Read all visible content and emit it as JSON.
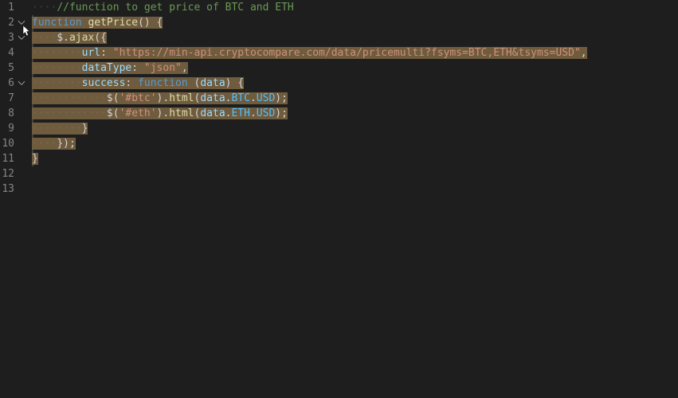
{
  "lines": [
    {
      "n": 1,
      "fold": false,
      "sel": [],
      "tokens": [
        {
          "t": "ws",
          "v": "····"
        },
        {
          "t": "comment",
          "v": "//function to get price of BTC and ETH"
        }
      ]
    },
    {
      "n": 2,
      "fold": true,
      "sel": [
        [
          0,
          99
        ]
      ],
      "tokens": [
        {
          "t": "keyword",
          "v": "function"
        },
        {
          "t": "punct",
          "v": " "
        },
        {
          "t": "funcname",
          "v": "getPrice"
        },
        {
          "t": "punct",
          "v": "() {"
        }
      ]
    },
    {
      "n": 3,
      "fold": true,
      "sel": [
        [
          0,
          99
        ]
      ],
      "tokens": [
        {
          "t": "ws",
          "v": "····"
        },
        {
          "t": "ident",
          "v": "$"
        },
        {
          "t": "punct",
          "v": "."
        },
        {
          "t": "funcname",
          "v": "ajax"
        },
        {
          "t": "punct",
          "v": "({"
        }
      ]
    },
    {
      "n": 4,
      "fold": false,
      "sel": [
        [
          0,
          99
        ]
      ],
      "tokens": [
        {
          "t": "ws",
          "v": "········"
        },
        {
          "t": "prop",
          "v": "url"
        },
        {
          "t": "punct",
          "v": ": "
        },
        {
          "t": "string",
          "v": "\"https://min-api.cryptocompare.com/data/pricemulti?fsyms=BTC,ETH&tsyms=USD\""
        },
        {
          "t": "punct",
          "v": ","
        }
      ]
    },
    {
      "n": 5,
      "fold": false,
      "sel": [
        [
          0,
          99
        ]
      ],
      "tokens": [
        {
          "t": "ws",
          "v": "········"
        },
        {
          "t": "prop",
          "v": "dataType"
        },
        {
          "t": "punct",
          "v": ": "
        },
        {
          "t": "string",
          "v": "\"json\""
        },
        {
          "t": "punct",
          "v": ","
        }
      ]
    },
    {
      "n": 6,
      "fold": true,
      "sel": [
        [
          0,
          99
        ]
      ],
      "tokens": [
        {
          "t": "ws",
          "v": "········"
        },
        {
          "t": "prop",
          "v": "success"
        },
        {
          "t": "punct",
          "v": ": "
        },
        {
          "t": "keyword",
          "v": "function"
        },
        {
          "t": "punct",
          "v": " ("
        },
        {
          "t": "param",
          "v": "data"
        },
        {
          "t": "punct",
          "v": ") {"
        }
      ]
    },
    {
      "n": 7,
      "fold": false,
      "sel": [
        [
          0,
          99
        ]
      ],
      "tokens": [
        {
          "t": "ws",
          "v": "············"
        },
        {
          "t": "ident",
          "v": "$"
        },
        {
          "t": "punct",
          "v": "("
        },
        {
          "t": "string",
          "v": "'#btc'"
        },
        {
          "t": "punct",
          "v": ")."
        },
        {
          "t": "funcname",
          "v": "html"
        },
        {
          "t": "punct",
          "v": "("
        },
        {
          "t": "param",
          "v": "data"
        },
        {
          "t": "punct",
          "v": "."
        },
        {
          "t": "var",
          "v": "BTC"
        },
        {
          "t": "punct",
          "v": "."
        },
        {
          "t": "var",
          "v": "USD"
        },
        {
          "t": "punct",
          "v": ");"
        }
      ]
    },
    {
      "n": 8,
      "fold": false,
      "sel": [
        [
          0,
          99
        ]
      ],
      "tokens": [
        {
          "t": "ws",
          "v": "············"
        },
        {
          "t": "ident",
          "v": "$"
        },
        {
          "t": "punct",
          "v": "("
        },
        {
          "t": "string",
          "v": "'#eth'"
        },
        {
          "t": "punct",
          "v": ")."
        },
        {
          "t": "funcname",
          "v": "html"
        },
        {
          "t": "punct",
          "v": "("
        },
        {
          "t": "param",
          "v": "data"
        },
        {
          "t": "punct",
          "v": "."
        },
        {
          "t": "var",
          "v": "ETH"
        },
        {
          "t": "punct",
          "v": "."
        },
        {
          "t": "var",
          "v": "USD"
        },
        {
          "t": "punct",
          "v": ");"
        }
      ]
    },
    {
      "n": 9,
      "fold": false,
      "sel": [
        [
          0,
          1
        ]
      ],
      "tokens": [
        {
          "t": "ws",
          "v": "········"
        },
        {
          "t": "punct",
          "v": "}"
        }
      ]
    },
    {
      "n": 10,
      "fold": false,
      "sel": [
        [
          0,
          1
        ]
      ],
      "tokens": [
        {
          "t": "ws",
          "v": "····"
        },
        {
          "t": "punct",
          "v": "});"
        }
      ]
    },
    {
      "n": 11,
      "fold": false,
      "sel": [
        [
          0,
          0
        ]
      ],
      "tokens": [
        {
          "t": "punct",
          "v": "}"
        }
      ]
    },
    {
      "n": 12,
      "fold": false,
      "sel": [],
      "tokens": []
    },
    {
      "n": 13,
      "fold": false,
      "sel": [],
      "tokens": []
    }
  ],
  "selection_lines_full": [
    2,
    3,
    4,
    5,
    6,
    7,
    8
  ],
  "selection_partial": {
    "9": 9,
    "10": 7,
    "11": 1
  }
}
